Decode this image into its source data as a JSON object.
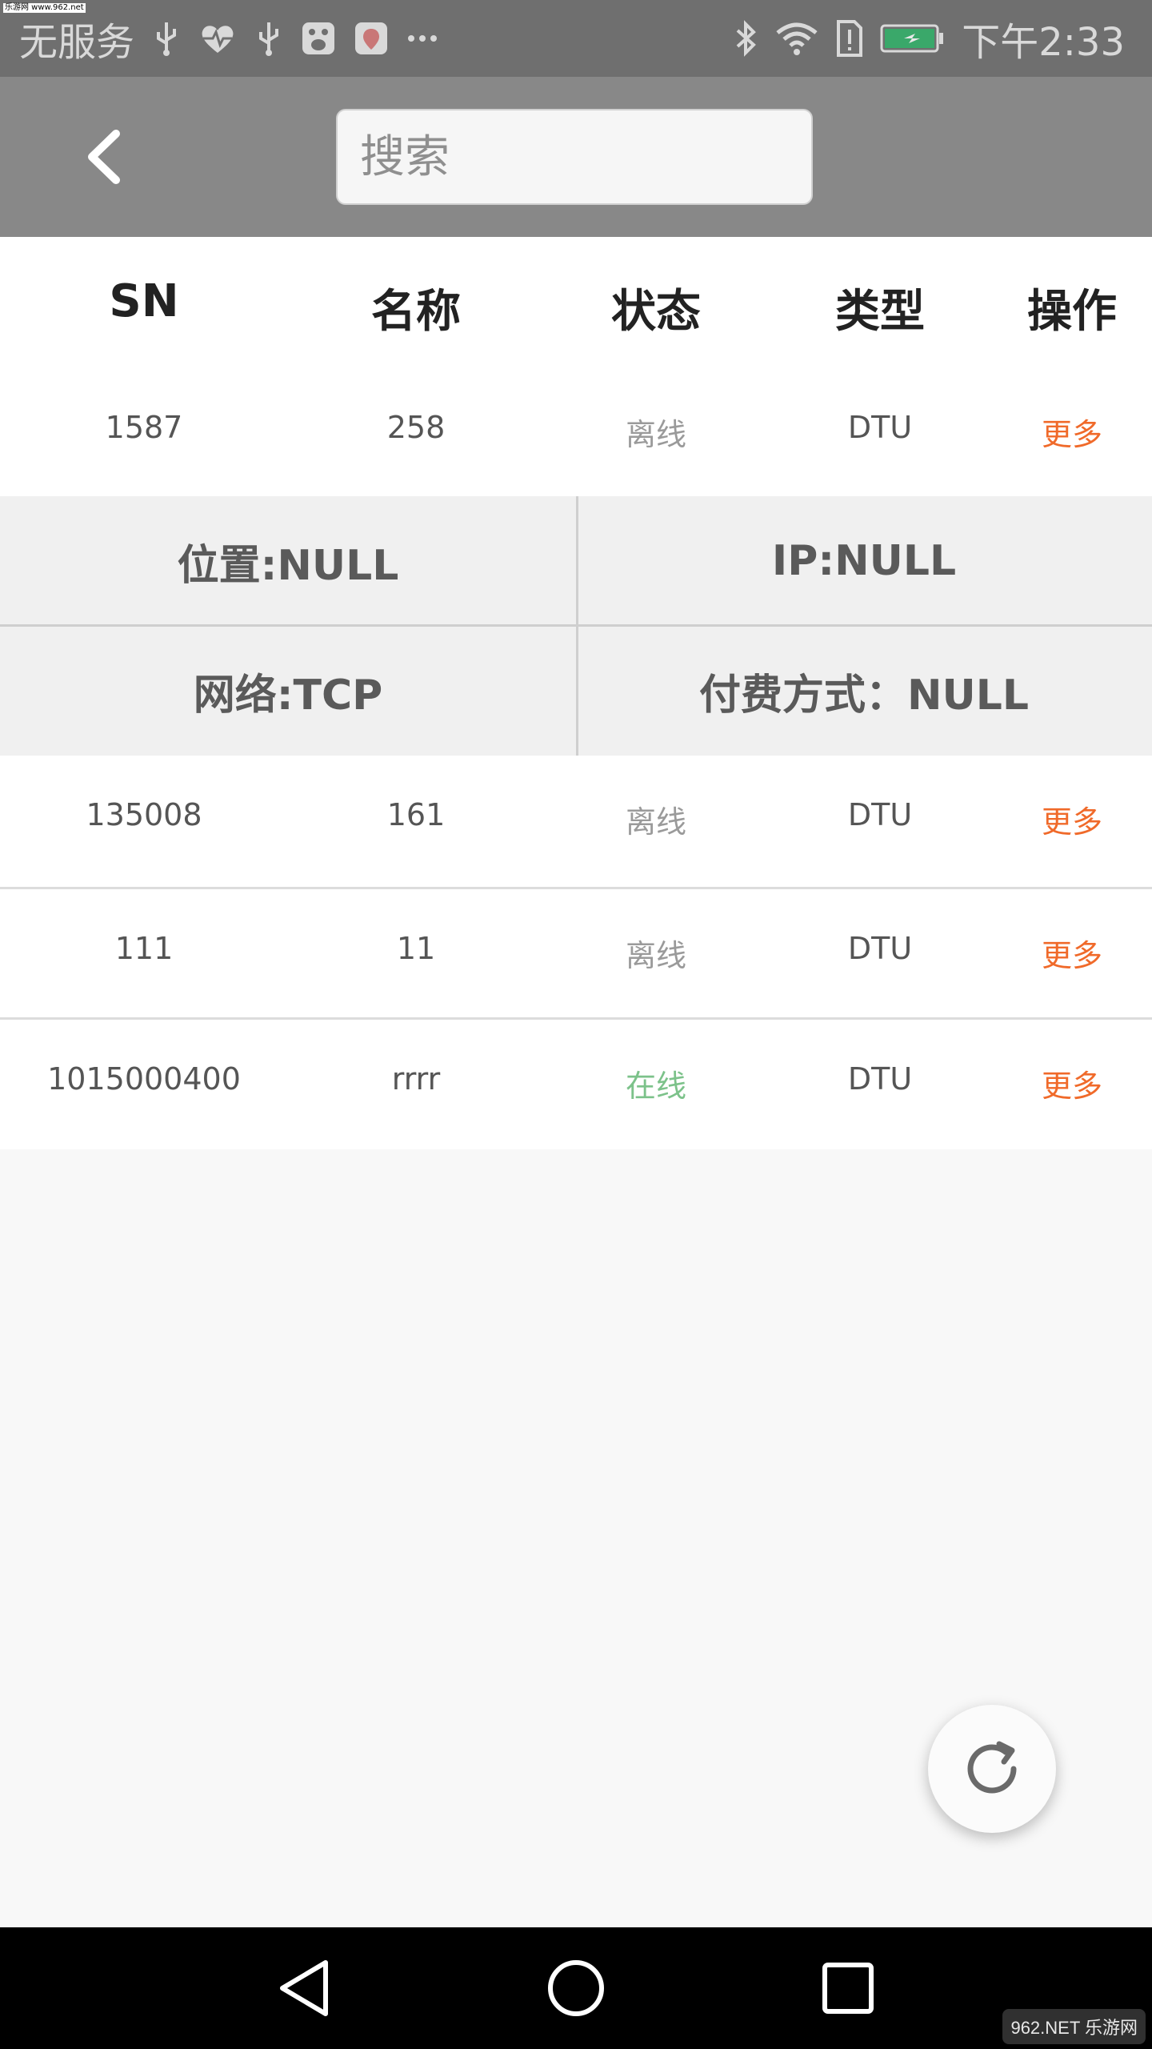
{
  "statusbar": {
    "tiny_label": "乐游网 www.962.net",
    "carrier": "无服务",
    "time": "下午2:33"
  },
  "appbar": {
    "search_placeholder": "搜索"
  },
  "table": {
    "headers": [
      "SN",
      "名称",
      "状态",
      "类型",
      "操作"
    ],
    "rows": [
      {
        "sn": "1587",
        "name": "258",
        "status": "离线",
        "type": "DTU",
        "action": "更多"
      },
      {
        "sn": "135008",
        "name": "161",
        "status": "离线",
        "type": "DTU",
        "action": "更多"
      },
      {
        "sn": "111",
        "name": "11",
        "status": "离线",
        "type": "DTU",
        "action": "更多"
      },
      {
        "sn": "1015000400",
        "name": "rrrr",
        "status": "在线",
        "type": "DTU",
        "action": "更多"
      }
    ]
  },
  "detail": {
    "location": "位置:NULL",
    "ip": "IP:NULL",
    "network": "网络:TCP",
    "payment": "付费方式：NULL"
  },
  "watermark": "962.NET 乐游网",
  "colors": {
    "appbar": "#888888",
    "statusbar": "#6f6f6f",
    "action": "#f06a2a",
    "online": "#7cc28a",
    "offline": "#9a9a9a"
  }
}
